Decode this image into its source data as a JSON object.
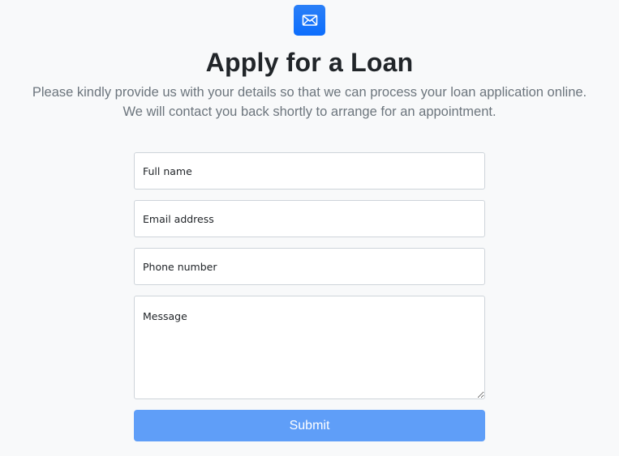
{
  "header": {
    "icon": "envelope-icon",
    "title": "Apply for a Loan",
    "lead_line_1": "Please kindly provide us with your details so that we can process your loan application online.",
    "lead_line_2": "We will contact you back shortly to arrange for an appointment."
  },
  "form": {
    "full_name_placeholder": "Full name",
    "email_placeholder": "Email address",
    "phone_placeholder": "Phone number",
    "message_placeholder": "Message",
    "submit_label": "Submit"
  },
  "colors": {
    "accent": "#0d6efd",
    "submit_bg": "#5f9ef8",
    "muted_text": "#6c757d",
    "page_bg": "#f8f9fa"
  }
}
